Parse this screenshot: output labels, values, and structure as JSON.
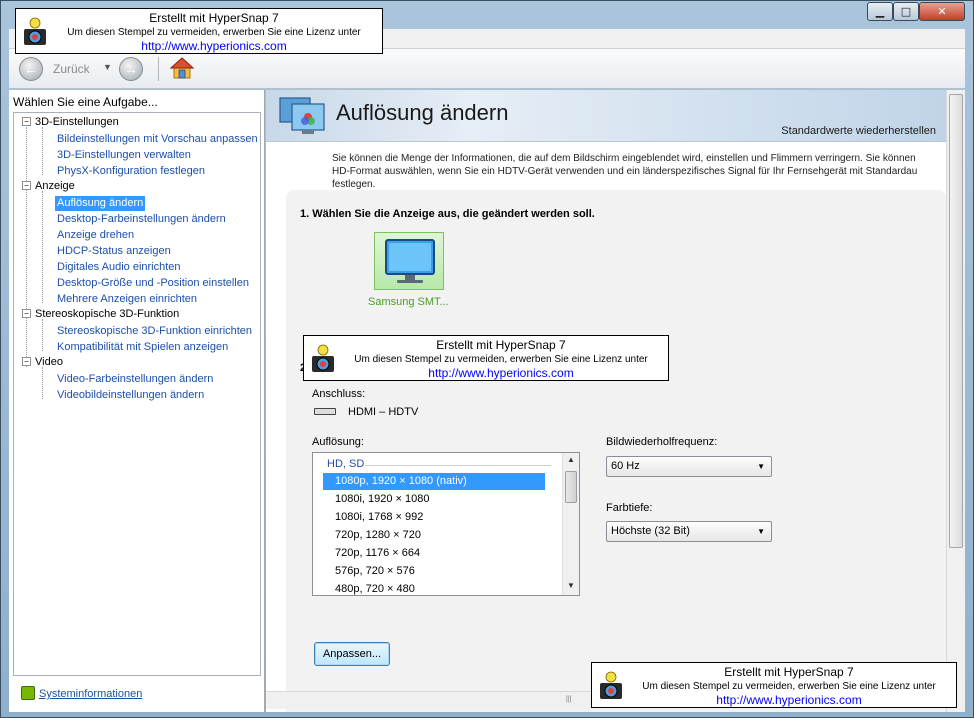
{
  "window": {
    "min_glyph": "▁",
    "max_glyph": "□",
    "close_glyph": "✕"
  },
  "toolbar": {
    "back_label": "Zurück",
    "back_icon": "back-arrow-icon",
    "forward_icon": "forward-arrow-icon",
    "home_icon": "home-icon"
  },
  "sidebar": {
    "header": "Wählen Sie eine Aufgabe...",
    "categories": [
      {
        "label": "3D-Einstellungen",
        "items": [
          "Bildeinstellungen mit Vorschau anpassen",
          "3D-Einstellungen verwalten",
          "PhysX-Konfiguration festlegen"
        ]
      },
      {
        "label": "Anzeige",
        "items": [
          "Auflösung ändern",
          "Desktop-Farbeinstellungen ändern",
          "Anzeige drehen",
          "HDCP-Status anzeigen",
          "Digitales Audio einrichten",
          "Desktop-Größe und -Position einstellen",
          "Mehrere Anzeigen einrichten"
        ]
      },
      {
        "label": "Stereoskopische 3D-Funktion",
        "items": [
          "Stereoskopische 3D-Funktion einrichten",
          "Kompatibilität mit Spielen anzeigen"
        ]
      },
      {
        "label": "Video",
        "items": [
          "Video-Farbeinstellungen ändern",
          "Videobildeinstellungen ändern"
        ]
      }
    ],
    "selected_item": "Auflösung ändern",
    "sysinfo": "Systeminformationen"
  },
  "page": {
    "title": "Auflösung ändern",
    "restore_defaults": "Standardwerte wiederherstellen",
    "description_1": "Sie können die Menge der Informationen, die auf dem Bildschirm eingeblendet wird, einstellen und Flimmern verringern. Sie können",
    "description_2": "HD-Format auswählen, wenn Sie ein HDTV-Gerät verwenden und ein länderspezifisches Signal für Ihr Fernsehgerät mit Standardau",
    "description_3": "festlegen.",
    "step1": "1. Wählen Sie die Anzeige aus, die geändert werden soll.",
    "monitor_label": "Samsung SMT...",
    "step2_num": "2",
    "connection_label": "Anschluss:",
    "connection_value": "HDMI – HDTV",
    "resolution_label": "Auflösung:",
    "resolution_group": "HD, SD",
    "resolutions": [
      "1080p, 1920 × 1080 (nativ)",
      "1080i, 1920 × 1080",
      "1080i, 1768 × 992",
      "720p, 1280 × 720",
      "720p, 1176 × 664",
      "576p, 720 × 576",
      "480p, 720 × 480"
    ],
    "selected_resolution": "1080p, 1920 × 1080 (nativ)",
    "refresh_label": "Bildwiederholfrequenz:",
    "refresh_value": "60 Hz",
    "depth_label": "Farbtiefe:",
    "depth_value": "Höchste (32 Bit)",
    "adjust_button": "Anpassen..."
  },
  "stamp": {
    "line1": "Erstellt mit HyperSnap 7",
    "line2": "Um diesen Stempel zu vermeiden, erwerben Sie eine Lizenz unter",
    "line3": "http://www.hyperionics.com"
  },
  "colors": {
    "link": "#1c4fa8",
    "selection": "#3399ff",
    "nvidia_green": "#76b900",
    "stamp_link": "#0000ff"
  }
}
